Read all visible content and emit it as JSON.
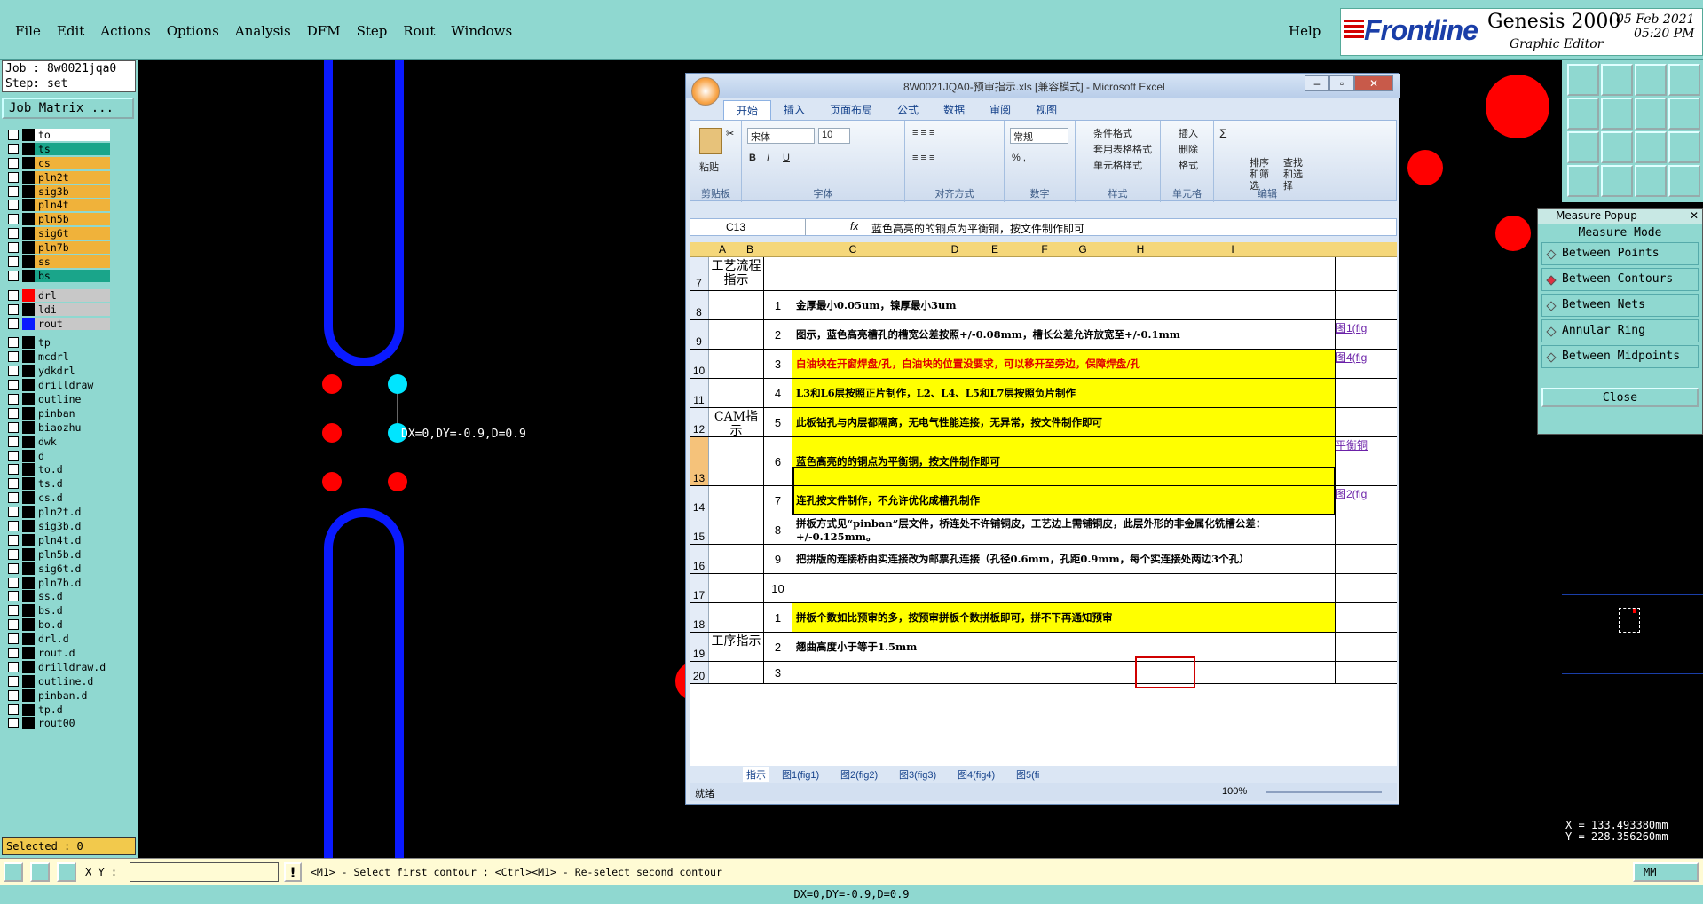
{
  "menu": {
    "items": [
      "File",
      "Edit",
      "Actions",
      "Options",
      "Analysis",
      "DFM",
      "Step",
      "Rout",
      "Windows"
    ],
    "help": "Help"
  },
  "branding": {
    "logo": "Frontline",
    "product": "Genesis 2000",
    "subtitle": "Graphic Editor",
    "date": "05 Feb 2021",
    "time": "05:20 PM"
  },
  "job": {
    "job_line": "Job : 8w0021jqa0",
    "step_line": "Step: set",
    "matrix_button": "Job Matrix ..."
  },
  "layers_group1": [
    {
      "name": "to",
      "color": "#ffffff"
    },
    {
      "name": "ts",
      "color": "#1aa58a"
    },
    {
      "name": "cs",
      "color": "#f0b23a"
    },
    {
      "name": "pln2t",
      "color": "#f0b23a"
    },
    {
      "name": "sig3b",
      "color": "#f0b23a"
    },
    {
      "name": "pln4t",
      "color": "#f0b23a"
    },
    {
      "name": "pln5b",
      "color": "#f0b23a"
    },
    {
      "name": "sig6t",
      "color": "#f0b23a"
    },
    {
      "name": "pln7b",
      "color": "#f0b23a"
    },
    {
      "name": "ss",
      "color": "#f0b23a"
    },
    {
      "name": "bs",
      "color": "#1aa58a"
    }
  ],
  "layers_group2": [
    {
      "name": "drl",
      "color": "#c8c8c8"
    },
    {
      "name": "ldi",
      "color": "#c8c8c8"
    },
    {
      "name": "rout",
      "color": "#c8c8c8"
    }
  ],
  "layers_group3": [
    {
      "name": "tp"
    },
    {
      "name": "mcdrl"
    },
    {
      "name": "ydkdrl"
    },
    {
      "name": "drilldraw"
    },
    {
      "name": "outline"
    },
    {
      "name": "pinban"
    },
    {
      "name": "biaozhu"
    },
    {
      "name": "dwk"
    },
    {
      "name": "d"
    },
    {
      "name": "to.d"
    },
    {
      "name": "ts.d"
    },
    {
      "name": "cs.d"
    },
    {
      "name": "pln2t.d"
    },
    {
      "name": "sig3b.d"
    },
    {
      "name": "pln4t.d"
    },
    {
      "name": "pln5b.d"
    },
    {
      "name": "sig6t.d"
    },
    {
      "name": "pln7b.d"
    },
    {
      "name": "ss.d"
    },
    {
      "name": "bs.d"
    },
    {
      "name": "bo.d"
    },
    {
      "name": "drl.d"
    },
    {
      "name": "rout.d"
    },
    {
      "name": "drilldraw.d"
    },
    {
      "name": "outline.d"
    },
    {
      "name": "pinban.d"
    },
    {
      "name": "tp.d"
    },
    {
      "name": "rout00"
    }
  ],
  "selected": "Selected : 0",
  "canvas": {
    "measure_label": "DX=0,DY=-0.9,D=0.9"
  },
  "excel": {
    "title": "8W0021JQA0-预审指示.xls  [兼容模式] - Microsoft Excel",
    "tabs": [
      "开始",
      "插入",
      "页面布局",
      "公式",
      "数据",
      "审阅",
      "视图"
    ],
    "ribbon": {
      "clipboard": "剪贴板",
      "paste": "粘贴",
      "font_group": "字体",
      "font_name": "宋体",
      "font_size": "10",
      "align_group": "对齐方式",
      "number_group": "数字",
      "number_format": "常规",
      "style_group": "样式",
      "cond_format": "条件格式",
      "table_format": "套用表格格式",
      "cell_style": "单元格样式",
      "cells_group": "单元格",
      "insert": "插入",
      "delete": "删除",
      "format": "格式",
      "edit_group": "编辑",
      "sort": "排序和筛选",
      "find": "查找和选择"
    },
    "name_box": "C13",
    "formula": "蓝色高亮的的铜点为平衡铜，按文件制作即可",
    "columns": [
      "A",
      "B",
      "C",
      "D",
      "E",
      "F",
      "G",
      "H",
      "I"
    ],
    "rows": [
      {
        "num": "7",
        "a": "工艺流程指示",
        "b": "",
        "c": "",
        "i": "",
        "yellow": false,
        "h": 38
      },
      {
        "num": "8",
        "a": "",
        "b": "1",
        "c": "金厚最小0.05um，镍厚最小3um",
        "i": "",
        "yellow": false,
        "h": 33
      },
      {
        "num": "9",
        "a": "",
        "b": "2",
        "c": "图示，蓝色高亮槽孔的槽宽公差按照+/-0.08mm，槽长公差允许放宽至+/-0.1mm",
        "i": "图1(fig",
        "yellow": false,
        "h": 33
      },
      {
        "num": "10",
        "a": "",
        "b": "3",
        "c": "白油块在开窗焊盘/孔，白油块的位置没要求，可以移开至旁边，保障焊盘/孔",
        "i": "图4(fig",
        "yellow": true,
        "red": true,
        "h": 33
      },
      {
        "num": "11",
        "a": "",
        "b": "4",
        "c": "L3和L6层按照正片制作，L2、L4、L5和L7层按照负片制作",
        "i": "",
        "yellow": true,
        "h": 33
      },
      {
        "num": "12",
        "a": "CAM指示",
        "b": "5",
        "c": "此板钻孔与内层都隔离，无电气性能连接，无异常，按文件制作即可",
        "i": "",
        "yellow": true,
        "h": 33
      },
      {
        "num": "13",
        "a": "",
        "b": "6",
        "c": "蓝色高亮的的铜点为平衡铜，按文件制作即可",
        "i": "平衡铜",
        "yellow": true,
        "h": 55
      },
      {
        "num": "14",
        "a": "",
        "b": "7",
        "c": "连孔按文件制作，不允许优化成槽孔制作",
        "i": "图2(fig",
        "yellow": true,
        "h": 33
      },
      {
        "num": "15",
        "a": "",
        "b": "8",
        "c": "拼板方式见“pinban”层文件，桥连处不许铺铜皮，工艺边上需铺铜皮，此层外形的非金属化铣槽公差：+/-0.125mm。",
        "i": "",
        "yellow": false,
        "h": 33
      },
      {
        "num": "16",
        "a": "",
        "b": "9",
        "c": "把拼版的连接桥由实连接改为邮票孔连接（孔径0.6mm，孔距0.9mm，每个实连接处两边3个孔）",
        "i": "",
        "yellow": false,
        "h": 33
      },
      {
        "num": "17",
        "a": "",
        "b": "10",
        "c": "",
        "i": "",
        "yellow": false,
        "h": 33
      },
      {
        "num": "18",
        "a": "",
        "b": "1",
        "c": "拼板个数如比预审的多，按预审拼板个数拼板即可，拼不下再通知预审",
        "i": "",
        "yellow": true,
        "h": 33
      },
      {
        "num": "19",
        "a": "工序指示",
        "b": "2",
        "c": "翘曲高度小于等于1.5mm",
        "i": "",
        "yellow": false,
        "h": 33
      },
      {
        "num": "20",
        "a": "",
        "b": "3",
        "c": "",
        "i": "",
        "yellow": false,
        "h": 25
      }
    ],
    "sheet_tabs": [
      "指示",
      "图1(fig1)",
      "图2(fig2)",
      "图3(fig3)",
      "图4(fig4)",
      "图5(fi"
    ],
    "status_left": "就绪",
    "zoom": "100%"
  },
  "measure": {
    "title": "Measure Popup",
    "mode_header": "Measure Mode",
    "options": [
      "Between Points",
      "Between Contours",
      "Between Nets",
      "Annular Ring",
      "Between Midpoints"
    ],
    "selected_option": "Between Contours",
    "close": "Close"
  },
  "coords": {
    "x": "X = 133.493380mm",
    "y": "Y = 228.356260mm"
  },
  "bottom": {
    "xy_label": "X Y :",
    "xy_value": "",
    "prompt": "<M1> - Select first contour ; <Ctrl><M1> - Re-select second contour",
    "units": "MM",
    "status": "DX=0,DY=-0.9,D=0.9"
  },
  "colors": {
    "panel": "#8fd8d0",
    "trace": "#0a1aff",
    "pad_red": "#ff0000",
    "pad_cyan": "#00e5ff",
    "excel_yellow": "#ffff00"
  }
}
